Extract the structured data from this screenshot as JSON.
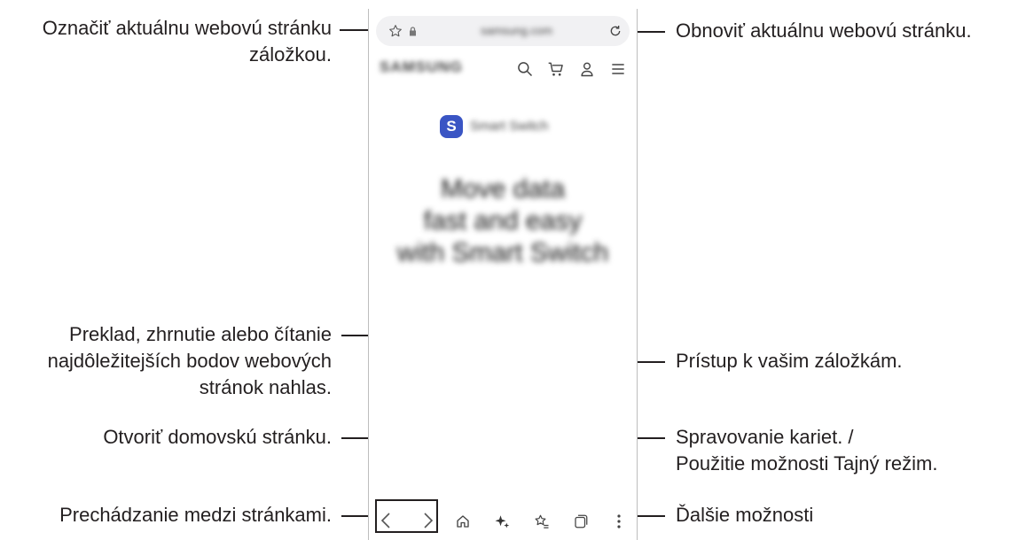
{
  "callouts": {
    "bookmark_page": [
      "Označiť aktuálnu webovú stránku",
      "záložkou."
    ],
    "refresh": "Obnoviť aktuálnu webovú stránku.",
    "summary": [
      "Preklad, zhrnutie alebo čítanie",
      "najdôležitejších bodov webových",
      "stránok nahlas."
    ],
    "bookmarks": "Prístup k vašim záložkám.",
    "home": "Otvoriť domovskú stránku.",
    "tabs": [
      "Spravovanie kariet. /",
      "Použitie možnosti Tajný režim."
    ],
    "navigate": "Prechádzanie medzi stránkami.",
    "more": "Ďalšie možnosti"
  },
  "browser": {
    "address": "samsung.com",
    "brand": "SAMSUNG",
    "app_name": "Smart Switch",
    "hero": [
      "Move data",
      "fast and easy",
      "with Smart Switch"
    ]
  },
  "icons": {
    "bookmark_star": "star-outline-icon",
    "lock": "lock-icon",
    "refresh": "refresh-icon",
    "search": "search-icon",
    "cart": "cart-icon",
    "account": "person-icon",
    "menu": "hamburger-icon",
    "back": "chevron-left-icon",
    "forward": "chevron-right-icon",
    "home": "home-icon",
    "ai": "sparkle-icon",
    "bookmarks": "star-list-icon",
    "tabs": "tabs-icon",
    "more": "vertical-dots-icon"
  },
  "colors": {
    "text": "#231f20",
    "app_icon": "#3a55c4"
  }
}
